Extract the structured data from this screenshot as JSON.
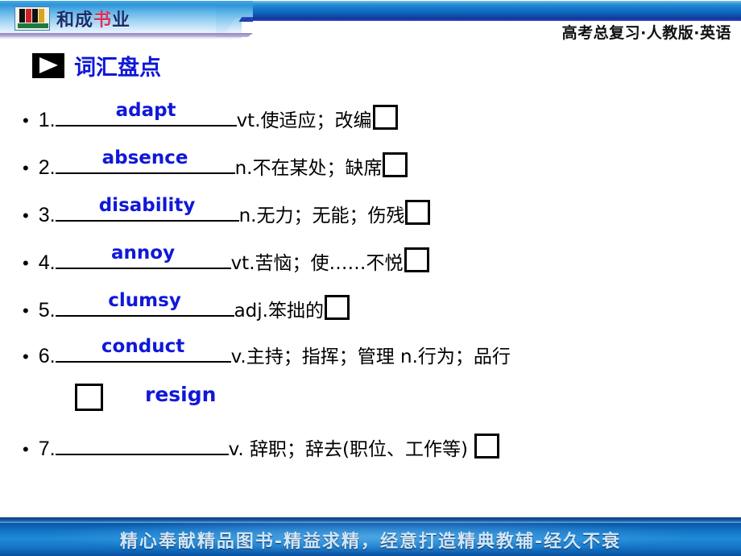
{
  "header": {
    "logo_text_left": "和成",
    "logo_text_accent": "书",
    "logo_text_right": "业",
    "title": "高考总复习·人教版·英语"
  },
  "section": {
    "marker_icon": "play-triangle-icon",
    "title": "词汇盘点"
  },
  "vocab": {
    "items": [
      {
        "number": "1.",
        "answer": "adapt",
        "meaning": "vt.使适应；改编",
        "checkbox": ""
      },
      {
        "number": "2.",
        "answer": "absence",
        "meaning": "n.不在某处；缺席",
        "checkbox": ""
      },
      {
        "number": "3.",
        "answer": "disability",
        "meaning": "n.无力；无能；伤残",
        "checkbox": ""
      },
      {
        "number": "4.",
        "answer": "annoy",
        "meaning": "vt.苦恼；使……不悦",
        "checkbox": ""
      },
      {
        "number": "5.",
        "answer": "clumsy",
        "meaning": " adj.笨拙的",
        "checkbox": ""
      },
      {
        "number": "6.",
        "answer": "conduct",
        "meaning": "v.主持；指挥；管理 n.行为；品行",
        "checkbox": ""
      },
      {
        "number": "7.",
        "answer": "",
        "meaning": "v. 辞职；辞去(职位、工作等)",
        "checkbox": ""
      }
    ],
    "wrapped_answer": "resign",
    "bullet": "•"
  },
  "footer": {
    "slogan": "精心奉献精品图书-精益求精，经意打造精典教辅-经久不衰"
  },
  "colors": {
    "answer_blue": "#1018d8",
    "title_blue": "#1018d8",
    "header_band": "#1577c9",
    "footer_band": "#1f8ad6"
  }
}
